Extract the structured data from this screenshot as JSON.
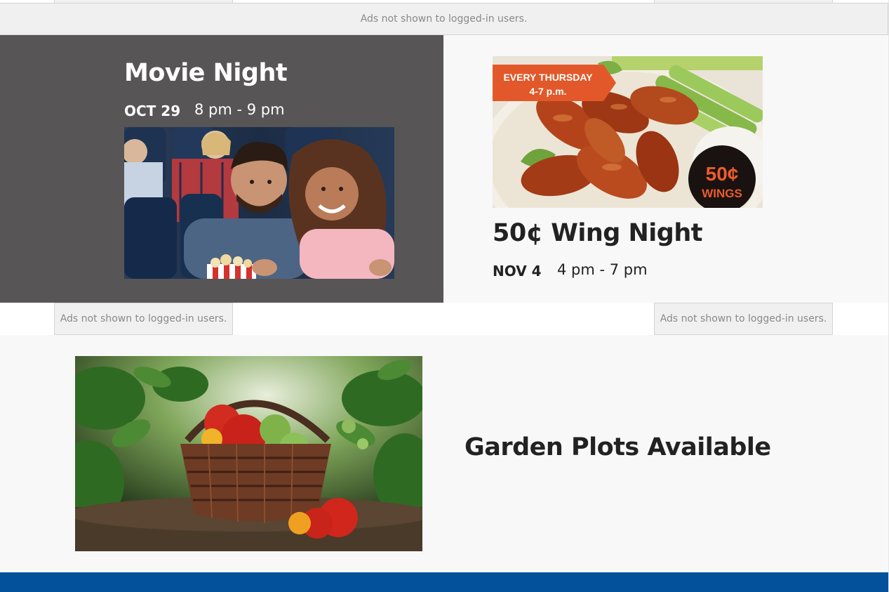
{
  "ads": {
    "notice": "Ads not shown to logged-in users."
  },
  "events": [
    {
      "title": "Movie Night",
      "date": "OCT 29",
      "time": "8 pm - 9 pm",
      "image": "couple-at-movie-theater-photo"
    },
    {
      "title": "50¢ Wing Night",
      "date": "NOV 4",
      "time": "4 pm - 7 pm",
      "image": "chicken-wings-promo-photo",
      "image_text": {
        "banner_line1": "EVERY THURSDAY",
        "banner_line2": "4-7 p.m.",
        "badge_price": "50¢",
        "badge_label": "WINGS"
      }
    }
  ],
  "garden": {
    "title": "Garden Plots Available",
    "image": "tomato-basket-photo"
  },
  "colors": {
    "dark_panel": "#575556",
    "light_panel": "#f8f8f8",
    "footer": "#03519b",
    "promo_orange": "#e2582a"
  }
}
